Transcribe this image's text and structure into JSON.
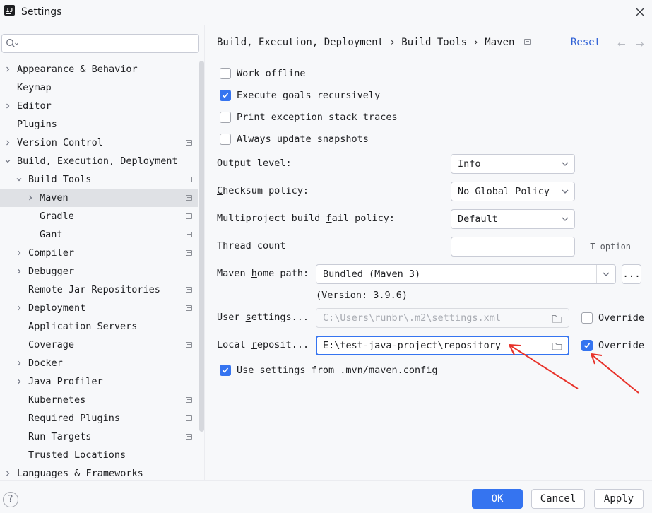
{
  "window": {
    "title": "Settings",
    "app_icon_text": "IJ"
  },
  "search": {
    "placeholder": ""
  },
  "sidebar": {
    "items": [
      {
        "label": "Appearance & Behavior",
        "level": 0,
        "chevron": "right",
        "bold": false,
        "proj": false
      },
      {
        "label": "Keymap",
        "level": 0,
        "chevron": "none",
        "proj": false
      },
      {
        "label": "Editor",
        "level": 0,
        "chevron": "right",
        "proj": false
      },
      {
        "label": "Plugins",
        "level": 0,
        "chevron": "none",
        "proj": false
      },
      {
        "label": "Version Control",
        "level": 0,
        "chevron": "right",
        "proj": true
      },
      {
        "label": "Build, Execution, Deployment",
        "level": 0,
        "chevron": "down",
        "proj": false
      },
      {
        "label": "Build Tools",
        "level": 1,
        "chevron": "down",
        "proj": true
      },
      {
        "label": "Maven",
        "level": 2,
        "chevron": "right",
        "proj": true,
        "selected": true
      },
      {
        "label": "Gradle",
        "level": 2,
        "chevron": "none",
        "proj": true
      },
      {
        "label": "Gant",
        "level": 2,
        "chevron": "none",
        "proj": true
      },
      {
        "label": "Compiler",
        "level": 1,
        "chevron": "right",
        "proj": true
      },
      {
        "label": "Debugger",
        "level": 1,
        "chevron": "right",
        "proj": false
      },
      {
        "label": "Remote Jar Repositories",
        "level": 1,
        "chevron": "none",
        "proj": true
      },
      {
        "label": "Deployment",
        "level": 1,
        "chevron": "right",
        "proj": true
      },
      {
        "label": "Application Servers",
        "level": 1,
        "chevron": "none",
        "proj": false
      },
      {
        "label": "Coverage",
        "level": 1,
        "chevron": "none",
        "proj": true
      },
      {
        "label": "Docker",
        "level": 1,
        "chevron": "right",
        "proj": false
      },
      {
        "label": "Java Profiler",
        "level": 1,
        "chevron": "right",
        "proj": false
      },
      {
        "label": "Kubernetes",
        "level": 1,
        "chevron": "none",
        "proj": true
      },
      {
        "label": "Required Plugins",
        "level": 1,
        "chevron": "none",
        "proj": true
      },
      {
        "label": "Run Targets",
        "level": 1,
        "chevron": "none",
        "proj": true
      },
      {
        "label": "Trusted Locations",
        "level": 1,
        "chevron": "none",
        "proj": false
      },
      {
        "label": "Languages & Frameworks",
        "level": 0,
        "chevron": "right",
        "proj": false
      }
    ]
  },
  "header": {
    "breadcrumb": "Build, Execution, Deployment › Build Tools › Maven",
    "reset_label": "Reset",
    "back_arrow": "←",
    "forward_arrow": "→"
  },
  "options": {
    "work_offline": {
      "label": "Work offline",
      "checked": false
    },
    "execute_goals": {
      "label": "Execute goals recursively",
      "checked": true
    },
    "print_exception": {
      "label": "Print exception stack traces",
      "checked": false
    },
    "always_update": {
      "label": "Always update snapshots",
      "checked": false
    },
    "use_mvn_config": {
      "label": "Use settings from .mvn/maven.config",
      "checked": true
    }
  },
  "fields": {
    "output_level": {
      "label_pre": "Output ",
      "label_u": "l",
      "label_post": "evel:",
      "value": "Info"
    },
    "checksum_policy": {
      "label_pre": "",
      "label_u": "C",
      "label_post": "hecksum policy:",
      "value": "No Global Policy"
    },
    "multiproject": {
      "label_pre": "Multiproject build ",
      "label_u": "f",
      "label_post": "ail policy:",
      "value": "Default"
    },
    "thread_count": {
      "label": "Thread count",
      "value": "",
      "hint": "-T option"
    },
    "maven_home": {
      "label_pre": "Maven ",
      "label_u": "h",
      "label_post": "ome path:",
      "value": "Bundled (Maven 3)",
      "browse_label": "...",
      "version": "(Version: 3.9.6)"
    },
    "user_settings": {
      "label_pre": "User ",
      "label_u": "s",
      "label_post": "ettings...",
      "value": "C:\\Users\\runbr\\.m2\\settings.xml",
      "override_label": "Override",
      "override_checked": false
    },
    "local_repo": {
      "label_pre": "Local ",
      "label_u": "r",
      "label_post": "eposit...",
      "value": "E:\\test-java-project\\repository",
      "override_label": "Override",
      "override_checked": true
    }
  },
  "footer": {
    "help_label": "?",
    "ok_label": "OK",
    "cancel_label": "Cancel",
    "apply_label": "Apply"
  },
  "colors": {
    "accent": "#3574f0",
    "link": "#2f61d6",
    "annotation": "#e8322a",
    "selection": "#dfe1e5"
  }
}
